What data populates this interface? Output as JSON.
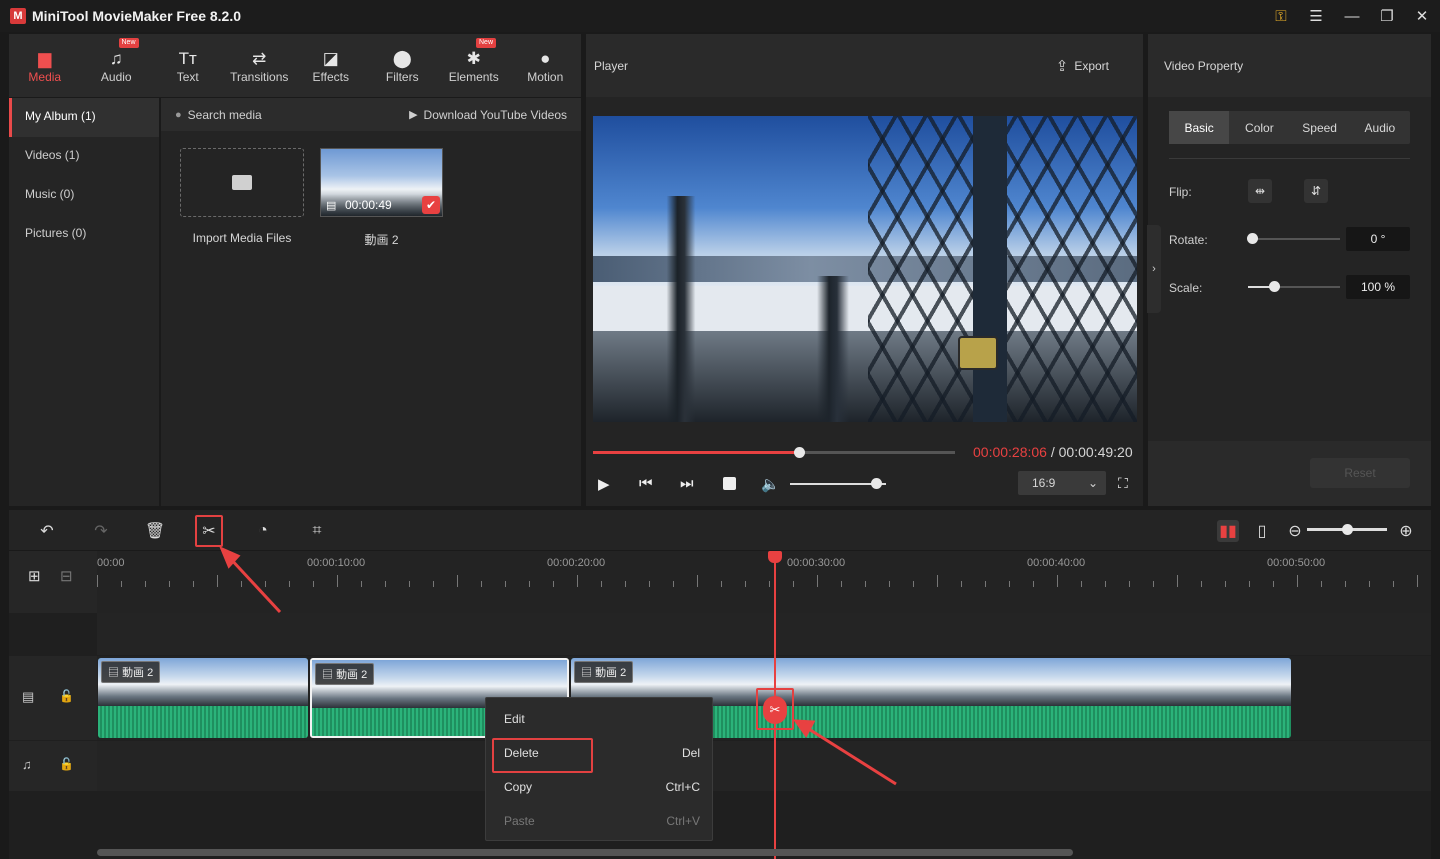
{
  "app": {
    "title": "MiniTool MovieMaker Free 8.2.0",
    "logo_letter": "M"
  },
  "toolbar": {
    "items": [
      {
        "label": "Media",
        "icon": "folder-icon",
        "active": true,
        "new": false
      },
      {
        "label": "Audio",
        "icon": "music-icon",
        "active": false,
        "new": true
      },
      {
        "label": "Text",
        "icon": "text-icon",
        "active": false,
        "new": false
      },
      {
        "label": "Transitions",
        "icon": "transitions-icon",
        "active": false,
        "new": false
      },
      {
        "label": "Effects",
        "icon": "effects-icon",
        "active": false,
        "new": false
      },
      {
        "label": "Filters",
        "icon": "filters-icon",
        "active": false,
        "new": false
      },
      {
        "label": "Elements",
        "icon": "elements-icon",
        "active": false,
        "new": true
      },
      {
        "label": "Motion",
        "icon": "motion-icon",
        "active": false,
        "new": false
      }
    ],
    "new_badge": "New"
  },
  "sidebar": {
    "items": [
      {
        "label": "My Album (1)",
        "active": true
      },
      {
        "label": "Videos (1)",
        "active": false
      },
      {
        "label": "Music (0)",
        "active": false
      },
      {
        "label": "Pictures (0)",
        "active": false
      }
    ]
  },
  "media": {
    "search_placeholder": "Search media",
    "download_label": "Download YouTube Videos",
    "import_label": "Import Media Files",
    "clip_name": "動画 2",
    "clip_duration": "00:00:49"
  },
  "player": {
    "title": "Player",
    "export_label": "Export",
    "current_time": "00:00:28:06",
    "separator": " / ",
    "total_time": "00:00:49:20",
    "progress": 0.57,
    "volume": 0.9,
    "aspect": "16:9"
  },
  "property": {
    "title": "Video Property",
    "tabs": [
      "Basic",
      "Color",
      "Speed",
      "Audio"
    ],
    "active_tab": "Basic",
    "flip_label": "Flip:",
    "rotate_label": "Rotate:",
    "rotate_value": "0 °",
    "rotate_level": 0.0,
    "scale_label": "Scale:",
    "scale_value": "100 %",
    "scale_level": 0.28,
    "reset_label": "Reset"
  },
  "timeline": {
    "ruler_labels": [
      "00:00",
      "00:00:10:00",
      "00:00:20:00",
      "00:00:30:00",
      "00:00:40:00",
      "00:00:50:00"
    ],
    "clips": [
      {
        "label": "動画 2"
      },
      {
        "label": "動画 2"
      },
      {
        "label": "動画 2"
      }
    ],
    "zoom_level": 0.5
  },
  "context_menu": {
    "items": [
      {
        "label": "Edit",
        "shortcut": "",
        "disabled": false
      },
      {
        "label": "Delete",
        "shortcut": "Del",
        "disabled": false
      },
      {
        "label": "Copy",
        "shortcut": "Ctrl+C",
        "disabled": false
      },
      {
        "label": "Paste",
        "shortcut": "Ctrl+V",
        "disabled": true
      }
    ]
  },
  "colors": {
    "accent": "#e84141",
    "panel": "#242424",
    "waveform": "#2bb37a"
  }
}
